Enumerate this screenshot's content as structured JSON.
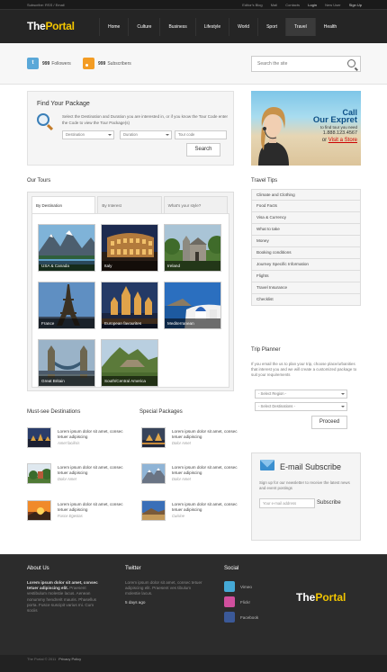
{
  "topline": {
    "left": "Subscribe: RSS / Email",
    "right": [
      "Editor's Blog",
      "Mail",
      "Contacts",
      "Login",
      "New User",
      "Sign Up"
    ]
  },
  "logo": {
    "part1": "The",
    "part2": "Portal"
  },
  "nav": [
    "Home",
    "Culture",
    "Business",
    "Lifestyle",
    "World",
    "Sport",
    "Travel",
    "Health"
  ],
  "nav_active": "Travel",
  "social": {
    "followers_count": "999",
    "followers_label": "Followers",
    "subscribers_count": "999",
    "subscribers_label": "Subscribers",
    "search_placeholder": "Search the site"
  },
  "find_package": {
    "title": "Find Your Package",
    "text": "Select the Destination and Duration you are interested in, or if you know the Tour Code enter the Code to view the Tour Package(s)",
    "destination": "Destination",
    "duration": "Duration",
    "tour_code": "Tour code",
    "search_button": "Search"
  },
  "callad": {
    "line1": "Call",
    "line2": "Our Expret",
    "line3": "to find tour you need",
    "phone": "1.888.123.4567",
    "or": "or",
    "link": "Visit a Store"
  },
  "our_tours": {
    "title": "Our Tours",
    "tabs": [
      "By Destination",
      "By Interest",
      "What's your style?"
    ],
    "cards": [
      {
        "label": "USA & Canada"
      },
      {
        "label": "Italy"
      },
      {
        "label": "Ireland"
      },
      {
        "label": "France"
      },
      {
        "label": "European favourites"
      },
      {
        "label": "Mediterranean"
      },
      {
        "label": "Great Britain"
      },
      {
        "label": "South/Central America"
      }
    ]
  },
  "travel_tips": {
    "title": "Travel Tips",
    "items": [
      "Climate and Clothing",
      "Food Facts",
      "Visa & Currency",
      "What to take",
      "Money",
      "Booking conditions",
      "Journey Specific Information",
      "Flights",
      "Travel Insurance",
      "Checklist"
    ]
  },
  "trip_planner": {
    "title": "Trip Planner",
    "text": "If you email the us to plan your trip, choose place/urbanities that interest you and we will create a customized package to suit your requirements",
    "region": "- Select Region -",
    "destinations": "- Select Destinations -",
    "proceed": "Proceed"
  },
  "esubscribe": {
    "title": "E-mail Subscribe",
    "text": "Sign up for our newsletter to receive the latest news and event postings",
    "placeholder": "Your e-mail address",
    "button": "Subscribe"
  },
  "must_see": {
    "title": "Must-see Destinations",
    "items": [
      {
        "text": "Lorem ipsum dolor sit amet, consec tetuer adipiscing",
        "date": "Amet facilisis"
      },
      {
        "text": "Lorem ipsum dolor sit amet, consec tetuer adipiscing",
        "date": "Dolor Amet"
      },
      {
        "text": "Lorem ipsum dolor sit amet, consec tetuer adipiscing",
        "date": "Fusce Egestas"
      }
    ]
  },
  "special": {
    "title": "Special Packages",
    "items": [
      {
        "text": "Lorem ipsum dolor sit amet, consec tetuer adipiscing",
        "date": "Dolor Amet"
      },
      {
        "text": "Lorem ipsum dolor sit amet, consec tetuer adipiscing",
        "date": "Dolor Amet"
      },
      {
        "text": "Lorem ipsum dolor sit amet, consec tetuer adipiscing",
        "date": "Cuisine"
      }
    ]
  },
  "footer": {
    "about_title": "About Us",
    "about_bold": "Lorem ipsum dolor sit amet, consec tetuer adipiscing elit.",
    "about_text": "Praesent vestibulum molestie lacus. Aenean nonummy hendrerit mauris. Phasellus porta. Fusce suscipit varius mi. Cum sociis",
    "twitter_title": "Twitter",
    "twitter_text": "Lorem ipsum dolor sit amet, consec tetuer adipiscing elit. Praesent ves tibulum molestie lacus.",
    "twitter_date": "5 days ago",
    "social_title": "Social",
    "social_links": [
      {
        "label": "Vimeo",
        "color": "#45a9d6"
      },
      {
        "label": "Flickr",
        "color": "#d04f9d"
      },
      {
        "label": "Facebook",
        "color": "#3b5998"
      }
    ],
    "copyright": "The Portal © 2011",
    "privacy": "Privacy Policy"
  },
  "colors": {
    "accent": "#f2c500",
    "dark": "#252525",
    "link_red": "#c00"
  }
}
